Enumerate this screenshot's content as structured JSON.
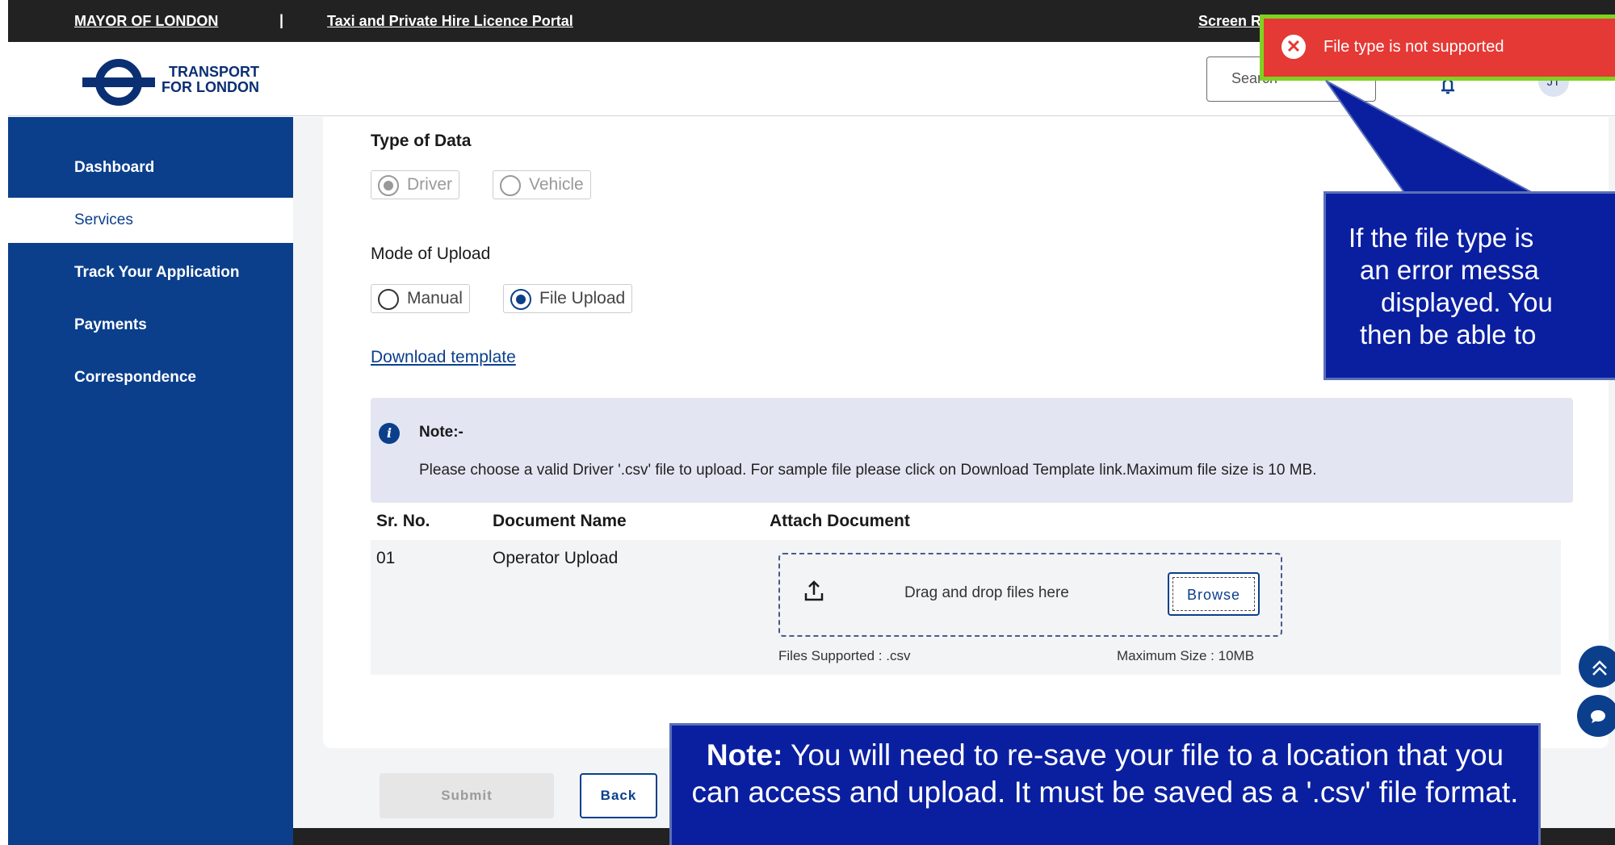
{
  "topbar": {
    "mayor_link": "MAYOR OF LONDON",
    "separator": "|",
    "portal_link": "Taxi and Private Hire Licence Portal",
    "screen_link": "Screen R"
  },
  "header": {
    "logo_line1": "TRANSPORT",
    "logo_line2": "FOR LONDON",
    "search_placeholder": "Search",
    "avatar_initials": "JT"
  },
  "sidebar": {
    "items": [
      {
        "label": "Dashboard"
      },
      {
        "label": "Services"
      },
      {
        "label": "Track Your Application"
      },
      {
        "label": "Payments"
      },
      {
        "label": "Correspondence"
      }
    ]
  },
  "form": {
    "type_of_data_label": "Type of Data",
    "type_options": [
      "Driver",
      "Vehicle"
    ],
    "type_selected": "Driver",
    "mode_label": "Mode of Upload",
    "mode_options": [
      "Manual",
      "File Upload"
    ],
    "mode_selected": "File Upload",
    "download_link": "Download template"
  },
  "note": {
    "title": "Note:-",
    "text": "Please choose a valid Driver '.csv' file to upload. For sample file please click on Download Template link.Maximum file size is 10 MB."
  },
  "table": {
    "headers": [
      "Sr. No.",
      "Document Name",
      "Attach Document"
    ],
    "rows": [
      {
        "sr": "01",
        "name": "Operator Upload"
      }
    ],
    "drop_text": "Drag and drop files here",
    "browse_label": "Browse",
    "files_supported": "Files Supported : .csv",
    "max_size": "Maximum Size : 10MB"
  },
  "buttons": {
    "submit": "Submit",
    "back": "Back"
  },
  "toast": {
    "message": "File type is not supported"
  },
  "callouts": {
    "right_lines": [
      "If the file type is",
      "an error messa",
      "displayed. You",
      "then be able to"
    ],
    "bottom_bold": "Note:",
    "bottom_text": " You will need to re-save your file to a location that you can access and upload. It must be saved as a '.csv' file format."
  },
  "colors": {
    "brand_blue": "#0b3f8c",
    "toast_red": "#e53935",
    "callout_blue": "#0a1fa0"
  }
}
